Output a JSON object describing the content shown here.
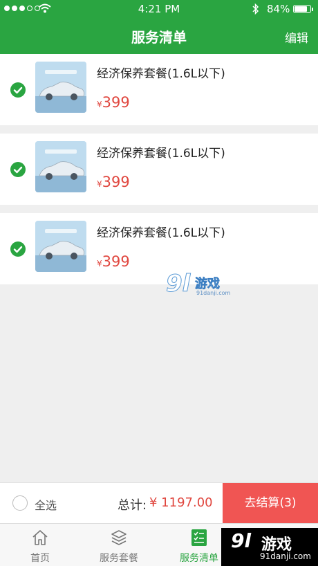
{
  "status_bar": {
    "time": "4:21 PM",
    "battery_percent": "84%"
  },
  "header": {
    "title": "服务清单",
    "edit_label": "编辑"
  },
  "items": [
    {
      "name": "经济保养套餐(1.6L以下)",
      "currency": "¥",
      "price": "399",
      "selected": true
    },
    {
      "name": "经济保养套餐(1.6L以下)",
      "currency": "¥",
      "price": "399",
      "selected": true
    },
    {
      "name": "经济保养套餐(1.6L以下)",
      "currency": "¥",
      "price": "399",
      "selected": true
    }
  ],
  "watermark": {
    "logo": "9l",
    "text": "游戏",
    "url": "91danji.com"
  },
  "checkout": {
    "select_all_label": "全选",
    "total_label": "总计:",
    "total_value": "¥ 1197.00",
    "checkout_label": "去结算(3)"
  },
  "tabs": [
    {
      "label": "首页",
      "icon": "home-icon"
    },
    {
      "label": "服务套餐",
      "icon": "layers-icon"
    },
    {
      "label": "服务清单",
      "icon": "checklist-icon",
      "active": true
    }
  ],
  "corner_logo": {
    "logo": "9l",
    "text": "游戏",
    "url": "91danji.com"
  },
  "colors": {
    "primary": "#2aa541",
    "price": "#e0463e",
    "checkout_button": "#f05553"
  }
}
